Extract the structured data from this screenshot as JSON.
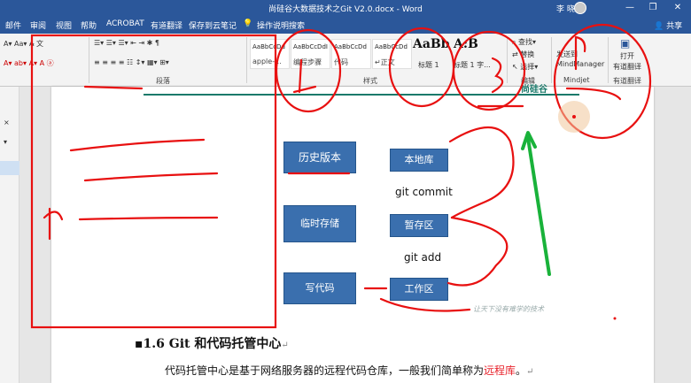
{
  "window": {
    "title": "尚硅谷大数据技术之Git V2.0.docx - Word",
    "user": "李 晓金",
    "controls": [
      "—",
      "❐",
      "✕"
    ]
  },
  "ribbon_tabs": [
    "邮件",
    "审阅",
    "视图",
    "帮助",
    "ACROBAT",
    "有道翻译",
    "保存到云笔记"
  ],
  "tell_me": "操作说明搜索",
  "share": "共享",
  "styles": [
    {
      "sample": "AaBbCcDd",
      "name": "apple-..."
    },
    {
      "sample": "AaBbCcDdI",
      "name": "编程步骤"
    },
    {
      "sample": "AaBbCcDd",
      "name": "代码"
    },
    {
      "sample": "AaBbCcDd",
      "name": "↵正文"
    }
  ],
  "heading_styles": [
    {
      "sample": "AaBb",
      "name": "标题 1"
    },
    {
      "sample": "A:B",
      "name": "标题 1 字..."
    }
  ],
  "groups": {
    "paragraph": "段落",
    "styles": "样式",
    "editing": "编辑",
    "mindjet": "Mindjet",
    "youdao": "有道翻译"
  },
  "editing": {
    "find": "查找",
    "replace": "替换",
    "select": "选择"
  },
  "mindjet_btn": {
    "line1": "发送到",
    "line2": "MindManager"
  },
  "youdao_btn": {
    "line1": "打开",
    "line2": "有道翻译"
  },
  "diagram": {
    "nodes": {
      "local_repo": "本地库",
      "staging": "暂存区",
      "workspace": "工作区"
    },
    "side_labels": {
      "history": "历史版本",
      "temp_store": "临时存储",
      "write_code": "写代码"
    },
    "edges": {
      "commit": "git commit",
      "add": "git add"
    }
  },
  "watermark": "让天下没有难学的技术",
  "logo": "尚硅谷",
  "section": {
    "number": "1.6",
    "title": "Git 和代码托管中心",
    "para_before": "代码托管中心是基于网络服务器的远程代码仓库，一般我们简单称为",
    "para_highlight": "远程库",
    "para_after": "。"
  },
  "colors": {
    "title_blue": "#2b579a",
    "node_blue": "#3a6fae",
    "annotation_red": "#e81010",
    "annotation_green": "#19b23a",
    "highlight_red": "#e8222b"
  }
}
